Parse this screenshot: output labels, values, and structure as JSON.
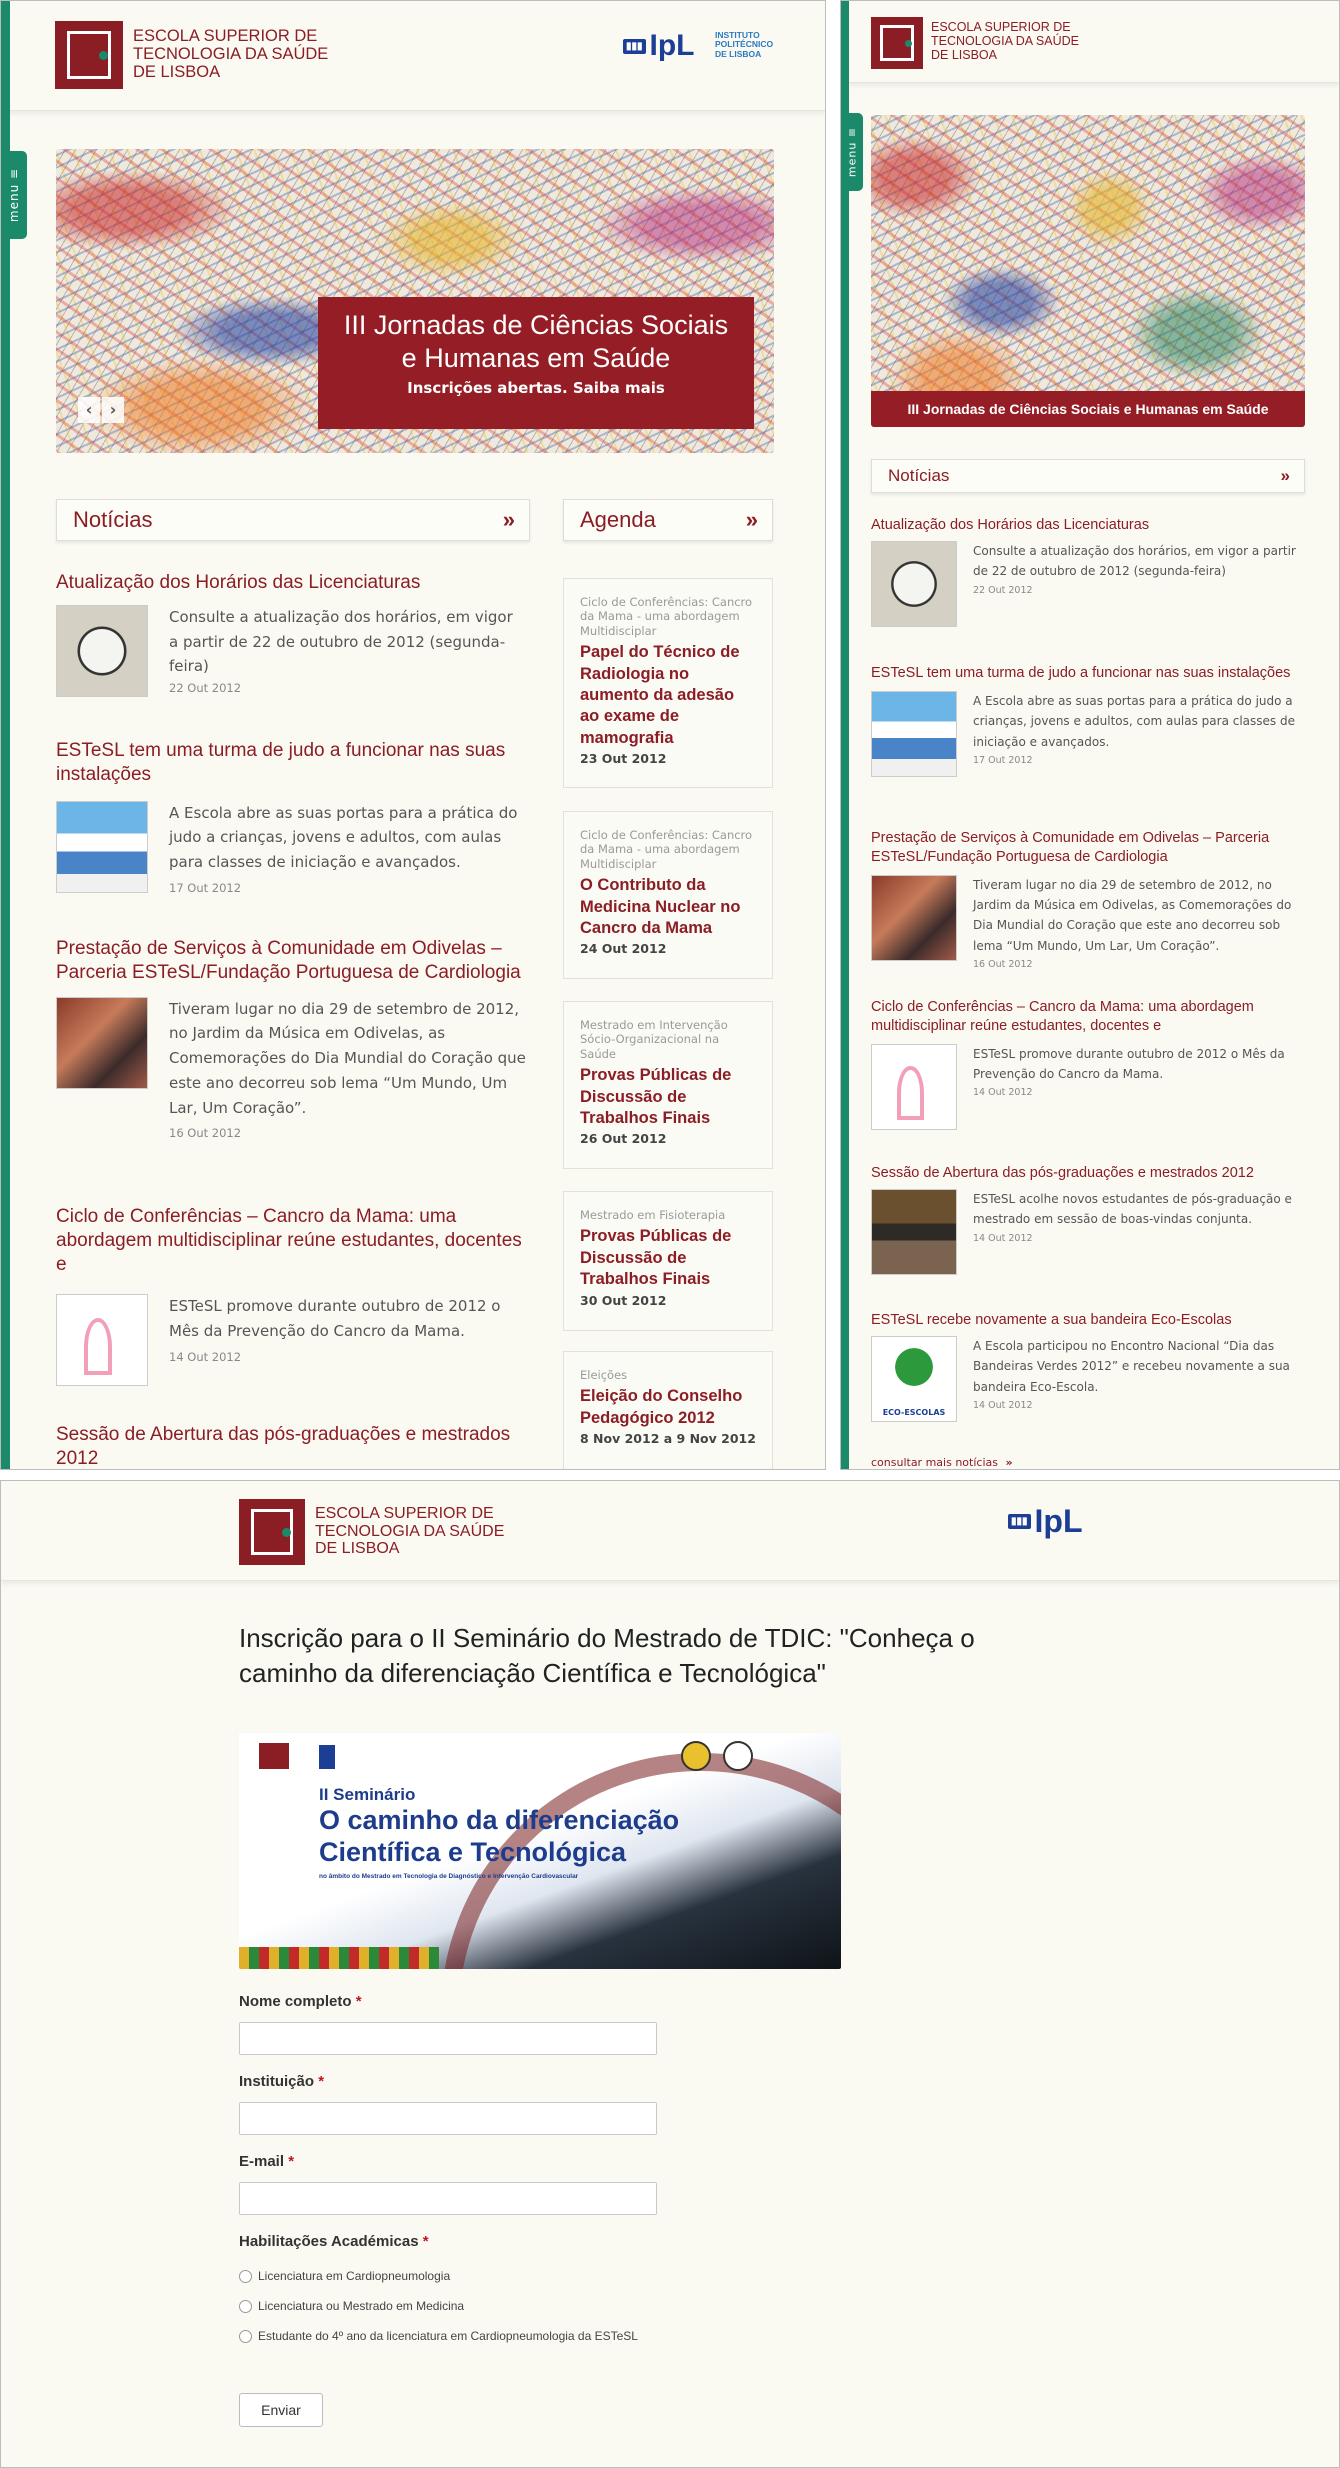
{
  "brand": {
    "school_name": [
      "ESCOLA SUPERIOR DE",
      "TECNOLOGIA DA SAÚDE",
      "DE LISBOA"
    ],
    "ipl_logo": "IpL",
    "ipl_sub": [
      "INSTITUTO",
      "POLITÉCNICO",
      "DE LISBOA"
    ],
    "ipl_bars": "▮▮▮",
    "colors": {
      "primary": "#8b1d24",
      "accent": "#1a8a6b",
      "ipl": "#1c3f95"
    }
  },
  "menu_label": "menu ≡",
  "desktop": {
    "hero": {
      "title": "III Jornadas de Ciências Sociais e Humanas em Saúde",
      "subtitle": "Inscrições abertas. Saiba mais",
      "prev": "‹",
      "next": "›"
    },
    "news_header": "Notícias",
    "agenda_header": "Agenda",
    "more_icon": "»",
    "news": [
      {
        "title": "Atualização dos Horários das Licenciaturas",
        "body": "Consulte a atualização dos horários, em vigor a partir de 22 de outubro de 2012 (segunda-feira)",
        "date": "22 Out 2012",
        "thumb": "clock"
      },
      {
        "title": "ESTeSL tem uma turma de judo a funcionar nas suas instalações",
        "body": "A Escola abre as suas portas para a prática do judo a crianças, jovens e adultos, com aulas para classes de iniciação e avançados.",
        "date": "17 Out 2012",
        "thumb": "judo"
      },
      {
        "title": "Prestação de Serviços à Comunidade em Odivelas – Parceria ESTeSL/Fundação Portuguesa de Cardiologia",
        "body": "Tiveram lugar no dia 29 de setembro de 2012, no Jardim da Música em Odivelas, as Comemorações do Dia Mundial do Coração que este ano decorreu sob lema “Um Mundo, Um Lar, Um Coração”.",
        "date": "16 Out 2012",
        "thumb": "people"
      },
      {
        "title": "Ciclo de Conferências – Cancro da Mama: uma abordagem multidisciplinar reúne estudantes, docentes e",
        "body": "ESTeSL promove durante outubro de 2012 o Mês da Prevenção do Cancro da Mama.",
        "date": "14 Out 2012",
        "thumb": "ribbon"
      },
      {
        "title": "Sessão de Abertura das pós-graduações e mestrados 2012",
        "body": "",
        "date": "",
        "thumb": ""
      }
    ],
    "agenda": [
      {
        "category": "Ciclo de Conferências: Cancro da Mama - uma abordagem Multidisciplar",
        "title": "Papel do Técnico de Radiologia no aumento da adesão ao exame de mamografia",
        "date": "23 Out 2012"
      },
      {
        "category": "Ciclo de Conferências: Cancro da Mama - uma abordagem Multidisciplar",
        "title": "O Contributo da Medicina Nuclear no Cancro da Mama",
        "date": "24 Out 2012"
      },
      {
        "category": "Mestrado em Intervenção Sócio-Organizacional na Saúde",
        "title": "Provas Públicas de Discussão de Trabalhos Finais",
        "date": "26 Out 2012"
      },
      {
        "category": "Mestrado em Fisioterapia",
        "title": "Provas Públicas de Discussão de Trabalhos Finais",
        "date": "30 Out 2012"
      },
      {
        "category": "Eleições",
        "title": "Eleição do Conselho Pedagógico 2012",
        "date": "8 Nov 2012 a 9 Nov 2012"
      }
    ]
  },
  "mobile": {
    "hero_title": "III Jornadas de Ciências Sociais e Humanas em Saúde",
    "news_header": "Notícias",
    "more_icon": "»",
    "news": [
      {
        "title": "Atualização dos Horários das Licenciaturas",
        "body": "Consulte a atualização dos horários, em vigor a partir de 22 de outubro de 2012 (segunda-feira)",
        "date": "22 Out 2012",
        "thumb": "clock"
      },
      {
        "title": "ESTeSL tem uma turma de judo a funcionar nas suas instalações",
        "body": "A Escola abre as suas portas para a prática do judo a crianças, jovens e adultos, com aulas para classes de iniciação e avançados.",
        "date": "17 Out 2012",
        "thumb": "judo"
      },
      {
        "title": "Prestação de Serviços à Comunidade em Odivelas – Parceria ESTeSL/Fundação Portuguesa de Cardiologia",
        "body": "Tiveram lugar no dia 29 de setembro de 2012, no Jardim da Música em Odivelas, as Comemorações do Dia Mundial do Coração que este ano decorreu sob lema “Um Mundo, Um Lar, Um Coração”.",
        "date": "16 Out 2012",
        "thumb": "people"
      },
      {
        "title": "Ciclo de Conferências – Cancro da Mama: uma abordagem multidisciplinar reúne estudantes, docentes e",
        "body": "ESTeSL promove durante outubro de 2012 o Mês da Prevenção do Cancro da Mama.",
        "date": "14 Out 2012",
        "thumb": "ribbon"
      },
      {
        "title": "Sessão de Abertura das pós-graduações e mestrados 2012",
        "body": "ESTeSL acolhe novos estudantes de pós-graduação e mestrado em sessão de boas-vindas conjunta.",
        "date": "14 Out 2012",
        "thumb": "hall"
      },
      {
        "title": "ESTeSL recebe novamente a sua bandeira Eco-Escolas",
        "body": "A Escola participou no Encontro Nacional “Dia das Bandeiras Verdes 2012” e recebeu novamente a sua bandeira Eco-Escola.",
        "date": "14 Out 2012",
        "thumb": "eco"
      }
    ],
    "more_link": "consultar mais notícias"
  },
  "form": {
    "title": "Inscrição para o II Seminário do Mestrado de TDIC: \"Conheça o caminho da diferenciação Científica e Tecnológica\"",
    "banner": {
      "line1": "II Seminário",
      "line2": "O caminho da diferenciação",
      "line3": "Científica e Tecnológica",
      "line4": "no âmbito do Mestrado em Tecnologia de Diagnóstico e Intervenção Cardiovascular"
    },
    "required_mark": "*",
    "fields": [
      {
        "label": "Nome completo"
      },
      {
        "label": "Instituição"
      },
      {
        "label": "E-mail"
      }
    ],
    "radio_group_label": "Habilitações Académicas",
    "radio_options": [
      "Licenciatura em Cardiopneumologia",
      "Licenciatura ou Mestrado em Medicina",
      "Estudante do 4º ano da licenciatura em Cardiopneumologia da ESTeSL"
    ],
    "submit_label": "Enviar"
  }
}
